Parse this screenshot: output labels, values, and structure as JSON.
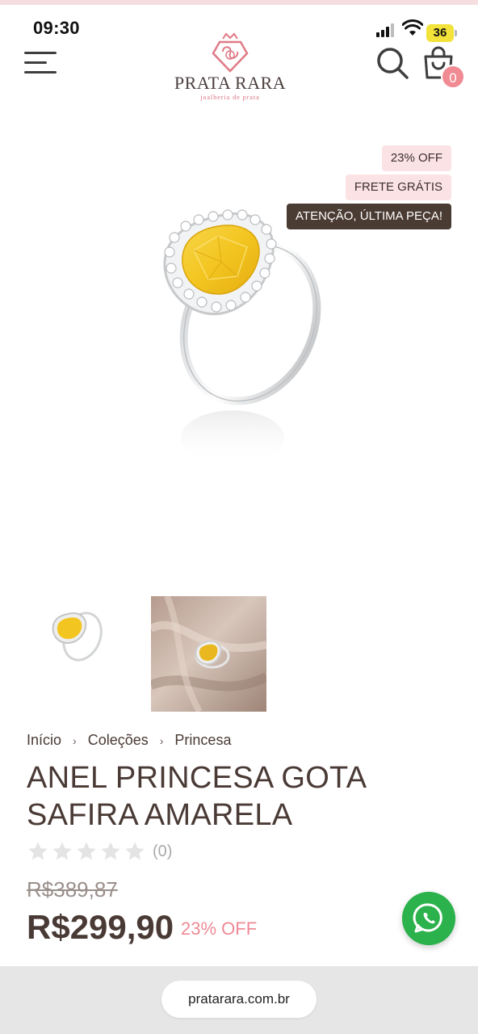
{
  "status_bar": {
    "time": "09:30",
    "battery": "36"
  },
  "header": {
    "logo_name": "PRATA RARA",
    "logo_tagline": "joalheria de prata",
    "cart_count": "0"
  },
  "badges": {
    "discount": "23% OFF",
    "shipping": "FRETE GRÁTIS",
    "last_piece": "ATENÇÃO, ÚLTIMA PEÇA!"
  },
  "breadcrumb": {
    "items": [
      "Início",
      "Coleções",
      "Princesa"
    ],
    "separator": "›"
  },
  "product": {
    "title": "ANEL PRINCESA GOTA SAFIRA AMARELA",
    "rating": 0,
    "rating_max": 5,
    "rating_count": "(0)",
    "old_price": "R$389,87",
    "price": "R$299,90",
    "discount_label": "23% OFF"
  },
  "icons": {
    "menu": "hamburger-menu-icon",
    "search": "search-icon",
    "cart": "shopping-bag-icon",
    "whatsapp": "whatsapp-icon",
    "star": "star-icon"
  },
  "colors": {
    "brand_pink": "#f08a93",
    "badge_bg": "#fbe3e5",
    "badge_dark": "#4a3b33",
    "text_brown": "#4a3a35",
    "whatsapp_green": "#2bb24c",
    "gem_yellow": "#f3c520"
  },
  "browser": {
    "url": "pratarara.com.br"
  }
}
